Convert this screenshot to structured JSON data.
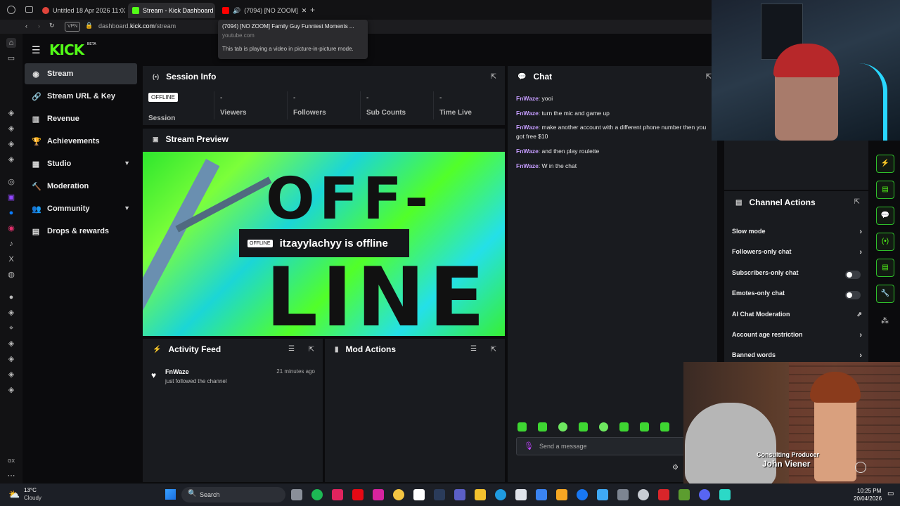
{
  "browser": {
    "tabs": [
      {
        "title": "Untitled 18 Apr 2026 11:03",
        "icon": "record-icon",
        "color": "#e0443b"
      },
      {
        "title": "Stream - Kick Dashboard",
        "icon": "kick-icon",
        "color": "#53fc18"
      },
      {
        "title": "(7094) [NO ZOOM]",
        "icon": "youtube-icon",
        "color": "#ff0000"
      }
    ],
    "new_tab": "+",
    "vpn": "VPN",
    "url_prefix": "dashboard.",
    "url_domain": "kick.com",
    "url_path": "/stream",
    "tooltip": {
      "title": "(7094) [NO ZOOM] Family Guy Funniest Moments ...",
      "site": "youtube.com",
      "note": "This tab is playing a video in picture-in-picture mode."
    }
  },
  "kick": {
    "logo": "KICK",
    "logo_tag": "BETA",
    "nav": [
      {
        "label": "Stream",
        "icon": "broadcast-icon",
        "active": true
      },
      {
        "label": "Stream URL & Key",
        "icon": "link-icon"
      },
      {
        "label": "Revenue",
        "icon": "chart-icon"
      },
      {
        "label": "Achievements",
        "icon": "trophy-icon"
      },
      {
        "label": "Studio",
        "icon": "studio-icon",
        "expand": true
      },
      {
        "label": "Moderation",
        "icon": "hammer-icon"
      },
      {
        "label": "Community",
        "icon": "users-icon",
        "expand": true
      },
      {
        "label": "Drops & rewards",
        "icon": "gift-icon"
      }
    ]
  },
  "session": {
    "title": "Session Info",
    "status_badge": "OFFLINE",
    "stats": [
      {
        "value": "",
        "label": "Session"
      },
      {
        "value": "-",
        "label": "Viewers"
      },
      {
        "value": "-",
        "label": "Followers"
      },
      {
        "value": "-",
        "label": "Sub Counts"
      },
      {
        "value": "-",
        "label": "Time Live"
      }
    ]
  },
  "preview": {
    "title": "Stream Preview",
    "art_line1": "OFF-",
    "art_line2": "LINE",
    "badge": "OFFLINE",
    "message": "itzayylachyy is offline"
  },
  "activity": {
    "title": "Activity Feed",
    "items": [
      {
        "user": "FnWaze",
        "text": "just followed the channel",
        "time": "21 minutes ago"
      }
    ]
  },
  "mod_actions": {
    "title": "Mod Actions"
  },
  "chat": {
    "title": "Chat",
    "messages": [
      {
        "user": "FnWaze",
        "text": ": yooi"
      },
      {
        "user": "FnWaze",
        "text": ": turn the mic and game up"
      },
      {
        "user": "FnWaze",
        "text": ": make another account with a different phone number then you got free $10"
      },
      {
        "user": "FnWaze",
        "text": ": and then play roulette"
      },
      {
        "user": "FnWaze",
        "text": ": W in the chat"
      }
    ],
    "input_placeholder": "Send a message"
  },
  "channel_actions": {
    "title": "Channel Actions",
    "items": [
      {
        "label": "Slow mode",
        "control": "chevron"
      },
      {
        "label": "Followers-only chat",
        "control": "chevron"
      },
      {
        "label": "Subscribers-only chat",
        "control": "toggle",
        "on": false
      },
      {
        "label": "Emotes-only chat",
        "control": "toggle",
        "on": false
      },
      {
        "label": "AI Chat Moderation",
        "control": "external"
      },
      {
        "label": "Account age restriction",
        "control": "chevron"
      },
      {
        "label": "Banned words",
        "control": "chevron"
      }
    ]
  },
  "pip": {
    "caption_role": "Consulting Producer",
    "caption_name": "John Viener"
  },
  "taskbar": {
    "weather_temp": "13°C",
    "weather_desc": "Cloudy",
    "search": "Search",
    "time": "10:25 PM",
    "date": "20/04/2026"
  },
  "colors": {
    "kick_green": "#53fc18",
    "panel": "#191b1f",
    "chat_user": "#c59cff"
  }
}
